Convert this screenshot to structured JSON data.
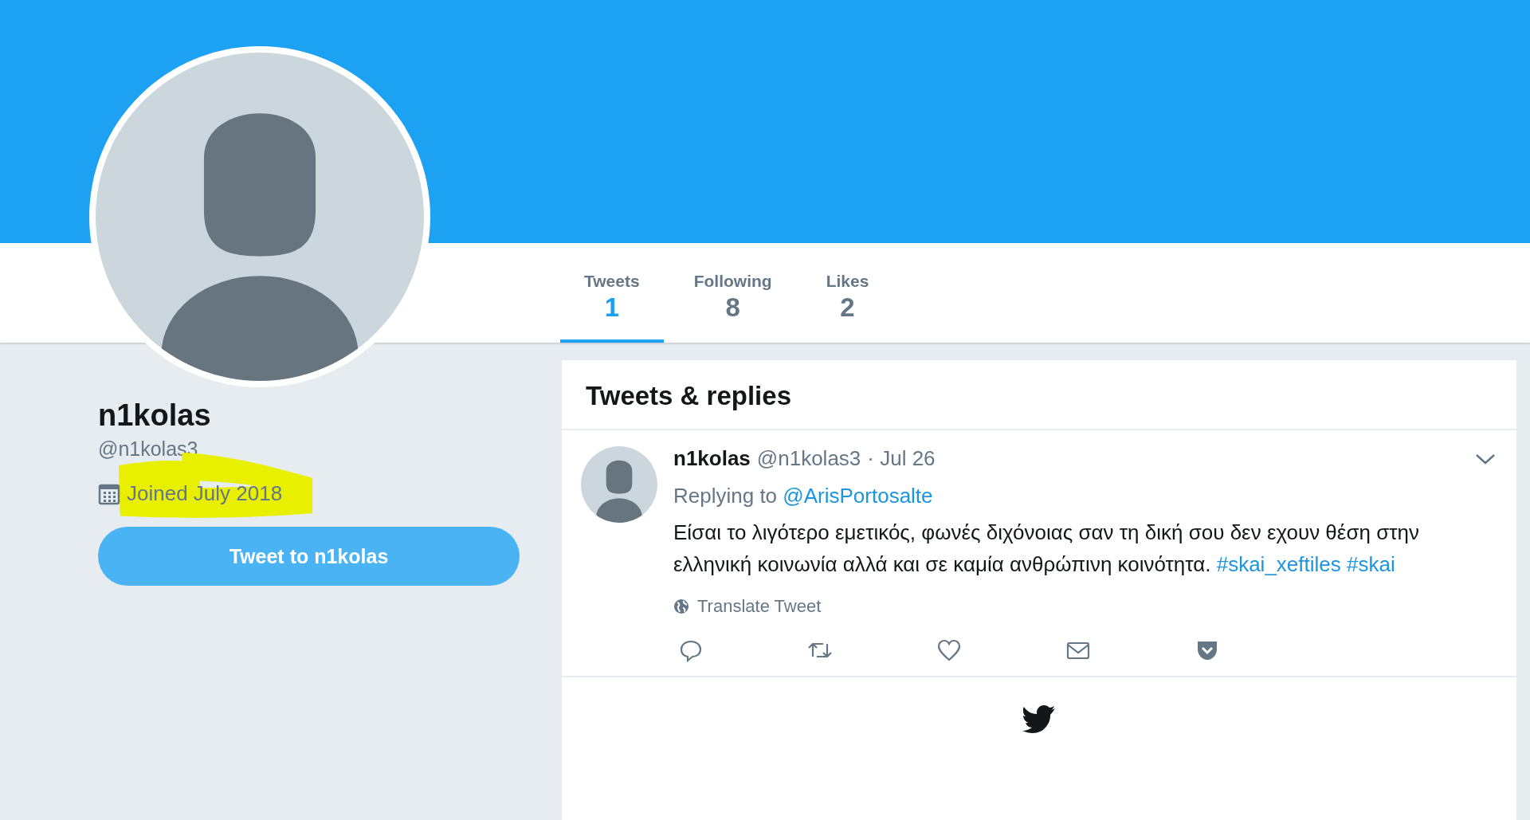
{
  "profile": {
    "name": "n1kolas",
    "handle": "@n1kolas3",
    "joined": "Joined July 2018",
    "tweet_button": "Tweet to n1kolas",
    "highlighted": true
  },
  "nav": {
    "tabs": [
      {
        "label": "Tweets",
        "count": "1",
        "selected": true
      },
      {
        "label": "Following",
        "count": "8",
        "selected": false
      },
      {
        "label": "Likes",
        "count": "2",
        "selected": false
      }
    ]
  },
  "timeline": {
    "title": "Tweets & replies",
    "tweets": [
      {
        "name": "n1kolas",
        "handle": "@n1kolas3",
        "date": "· Jul 26",
        "replying_prefix": "Replying to",
        "replying_to": "@ArisPortosalte",
        "text": "Είσαι το λιγότερο εμετικός, φωνές διχόνοιας σαν τη δική σου δεν εχουν θέση στην ελληνική κοινωνία αλλά και σε καμία ανθρώπινη κοινότητα.",
        "hashtags": [
          "#skai_xeftiles",
          "#skai"
        ],
        "translate": "Translate Tweet"
      }
    ]
  }
}
